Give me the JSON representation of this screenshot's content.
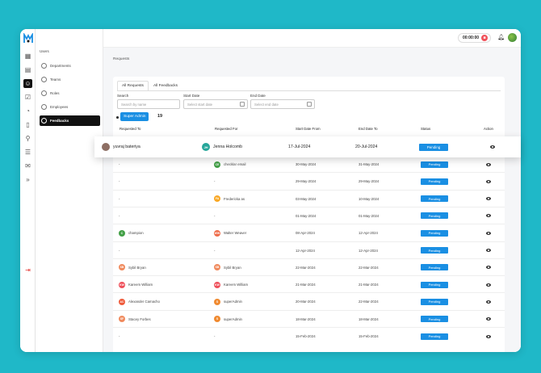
{
  "colors": {
    "background": "#1fb8c8",
    "accent": "#1a8fe3",
    "active_nav": "#111111",
    "danger": "#f0525a"
  },
  "rail": {
    "icons": [
      "grid-icon",
      "calendar-icon",
      "users-icon",
      "task-icon",
      "clock-icon",
      "document-icon",
      "search-user-icon",
      "report-icon",
      "chat-icon",
      "expand-icon"
    ],
    "active_index": 2,
    "logout_icon": "logout-icon"
  },
  "subnav": {
    "title": "Users",
    "items": [
      {
        "label": "Departments",
        "icon": "building-icon"
      },
      {
        "label": "Teams",
        "icon": "team-icon"
      },
      {
        "label": "Roles",
        "icon": "role-icon"
      },
      {
        "label": "Employees",
        "icon": "employee-icon"
      },
      {
        "label": "Feedbacks",
        "icon": "feedback-icon"
      }
    ],
    "active_index": 4
  },
  "topbar": {
    "timer": "00:00:00",
    "bell_icon": "bell-icon"
  },
  "main": {
    "breadcrumb": "Requests",
    "tabs": [
      "All Requests",
      "All Feedbacks"
    ],
    "active_tab": 0,
    "filters": {
      "search_label": "Search",
      "search_placeholder": "Search by name",
      "start_label": "Start Date",
      "start_placeholder": "Select start date",
      "end_label": "End Date",
      "end_placeholder": "Select end date"
    },
    "role": {
      "label": "Super Admin",
      "count": "19"
    },
    "columns": [
      "Requested To",
      "Requested For",
      "Start Date From",
      "End Date To",
      "Status",
      "Action"
    ],
    "highlighted_row": {
      "to": {
        "name": "yuvraj bateriya",
        "initials": "",
        "color": "#8d6e63"
      },
      "for": {
        "name": "Jenna Holcomb",
        "initials": "JH",
        "color": "#26a69a"
      },
      "start": "17-Jul-2024",
      "end": "20-Jul-2024",
      "status": "Pending"
    },
    "rows": [
      {
        "to": "-",
        "to_initials": "",
        "to_color": "",
        "for": "checklar email",
        "for_initials": "CE",
        "for_color": "#43a047",
        "start": "30-May-2024",
        "end": "31-May-2024",
        "status": "Pending"
      },
      {
        "to": "-",
        "to_initials": "",
        "to_color": "",
        "for": "-",
        "for_initials": "",
        "for_color": "",
        "start": "29-May-2024",
        "end": "29-May-2024",
        "status": "Pending"
      },
      {
        "to": "-",
        "to_initials": "",
        "to_color": "",
        "for": "Fredericka as",
        "for_initials": "FA",
        "for_color": "#f9a825",
        "start": "03-May-2024",
        "end": "10-May-2024",
        "status": "Pending"
      },
      {
        "to": "-",
        "to_initials": "",
        "to_color": "",
        "for": "-",
        "for_initials": "",
        "for_color": "",
        "start": "01-May-2024",
        "end": "01-May-2024",
        "status": "Pending"
      },
      {
        "to": "champion",
        "to_initials": "C",
        "to_color": "#43a047",
        "for": "Walter Weaver",
        "for_initials": "WW",
        "for_color": "#ef6c4a",
        "start": "08-Apr-2024",
        "end": "12-Apr-2024",
        "status": "Pending"
      },
      {
        "to": "-",
        "to_initials": "",
        "to_color": "",
        "for": "-",
        "for_initials": "",
        "for_color": "",
        "start": "12-Apr-2024",
        "end": "12-Apr-2024",
        "status": "Pending"
      },
      {
        "to": "Sybil Bryan",
        "to_initials": "SB",
        "to_color": "#f08a5d",
        "for": "Sybil Bryan",
        "for_initials": "SB",
        "for_color": "#f08a5d",
        "start": "22-Mar-2024",
        "end": "22-Mar-2024",
        "status": "Pending"
      },
      {
        "to": "Kareem William",
        "to_initials": "KW",
        "to_color": "#ef4f5a",
        "for": "Kareem William",
        "for_initials": "KW",
        "for_color": "#ef4f5a",
        "start": "21-Mar-2024",
        "end": "21-Mar-2024",
        "status": "Pending"
      },
      {
        "to": "Alexander Camacho",
        "to_initials": "AC",
        "to_color": "#ef5a3a",
        "for": "superAdmin",
        "for_initials": "S",
        "for_color": "#f08a30",
        "start": "20-Mar-2024",
        "end": "22-Mar-2024",
        "status": "Pending"
      },
      {
        "to": "Stacey Forbes",
        "to_initials": "SF",
        "to_color": "#f08a5d",
        "for": "superAdmin",
        "for_initials": "S",
        "for_color": "#f08a30",
        "start": "18-Mar-2024",
        "end": "18-Mar-2024",
        "status": "Pending"
      },
      {
        "to": "-",
        "to_initials": "",
        "to_color": "",
        "for": "-",
        "for_initials": "",
        "for_color": "",
        "start": "15-Feb-2024",
        "end": "15-Feb-2024",
        "status": "Pending"
      }
    ]
  }
}
